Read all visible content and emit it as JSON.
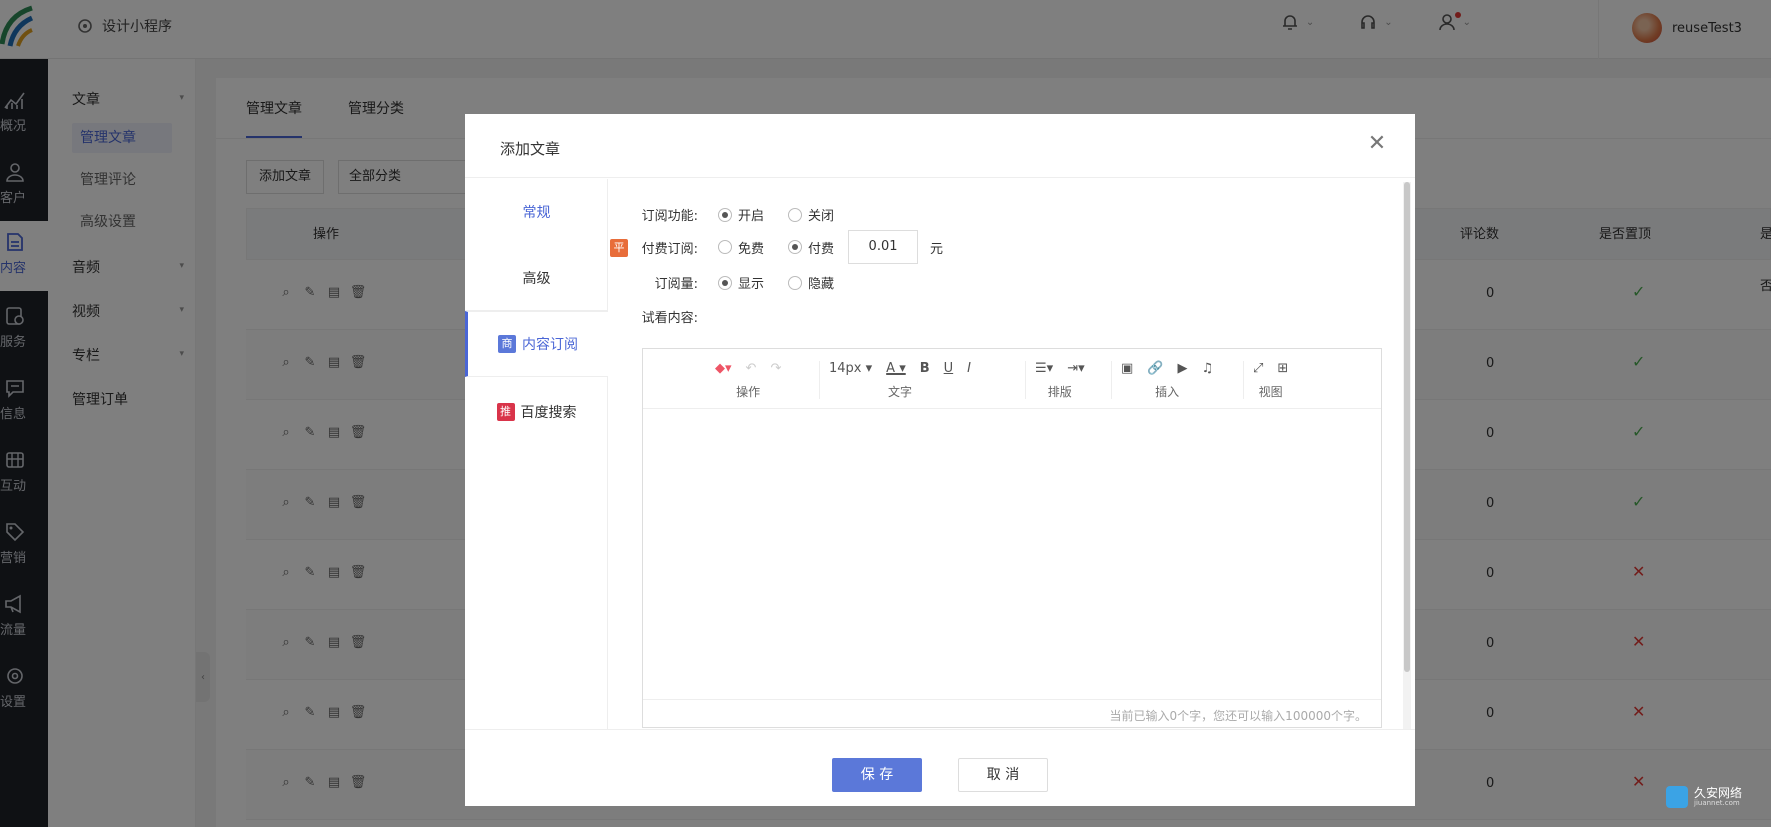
{
  "app": {
    "name": "设计小程序",
    "user": "reuseTest3"
  },
  "darknav": [
    {
      "label": "概况",
      "icon": "chart-icon"
    },
    {
      "label": "客户",
      "icon": "user-icon"
    },
    {
      "label": "内容",
      "icon": "document-icon"
    },
    {
      "label": "服务",
      "icon": "service-icon"
    },
    {
      "label": "信息",
      "icon": "message-icon"
    },
    {
      "label": "互动",
      "icon": "interact-icon"
    },
    {
      "label": "营销",
      "icon": "tag-icon"
    },
    {
      "label": "流量",
      "icon": "megaphone-icon"
    },
    {
      "label": "设置",
      "icon": "gear-icon"
    }
  ],
  "subnav": {
    "article": "文章",
    "items": [
      "管理文章",
      "管理评论",
      "高级设置"
    ],
    "audio": "音频",
    "video": "视频",
    "column": "专栏",
    "orders": "管理订单"
  },
  "main": {
    "tabs": [
      "管理文章",
      "管理分类"
    ],
    "add_button": "添加文章",
    "category_select": "全部分类",
    "columns": {
      "actions": "操作",
      "comments": "评论数",
      "pinned": "是否置顶",
      "shelf": "是否上架"
    },
    "rows": [
      {
        "comments": "0",
        "pinned": "✓",
        "pinned_ok": true
      },
      {
        "comments": "0",
        "pinned": "✓",
        "pinned_ok": true
      },
      {
        "comments": "0",
        "pinned": "✓",
        "pinned_ok": true
      },
      {
        "comments": "0",
        "pinned": "✓",
        "pinned_ok": true
      },
      {
        "comments": "0",
        "pinned": "✕",
        "pinned_ok": false
      },
      {
        "comments": "0",
        "pinned": "✕",
        "pinned_ok": false
      },
      {
        "comments": "0",
        "pinned": "✕",
        "pinned_ok": false
      },
      {
        "comments": "0",
        "pinned": "✕",
        "pinned_ok": false
      }
    ]
  },
  "modal": {
    "title": "添加文章",
    "side": [
      {
        "label": "常规"
      },
      {
        "label": "高级"
      },
      {
        "label": "内容订阅",
        "badge": "商"
      },
      {
        "label": "百度搜索",
        "badge": "推"
      }
    ],
    "form": {
      "subscribe_label": "订阅功能:",
      "subscribe_on": "开启",
      "subscribe_off": "关闭",
      "paid_badge": "平",
      "paid_label": "付费订阅:",
      "paid_free": "免费",
      "paid_paid": "付费",
      "price": "0.01",
      "unit": "元",
      "count_label": "订阅量:",
      "count_show": "显示",
      "count_hide": "隐藏",
      "preview_label": "试看内容:"
    },
    "editor": {
      "font_size": "14px",
      "groups": [
        "操作",
        "文字",
        "排版",
        "插入",
        "视图"
      ],
      "counter": "当前已输入0个字，您还可以输入100000个字。"
    },
    "save": "保 存",
    "cancel": "取 消"
  },
  "watermark": {
    "text": "久安网络",
    "sub": "jiuannet.com"
  },
  "colors": {
    "accent": "#5b78d9",
    "ok": "#4caf50",
    "no": "#e53935"
  }
}
